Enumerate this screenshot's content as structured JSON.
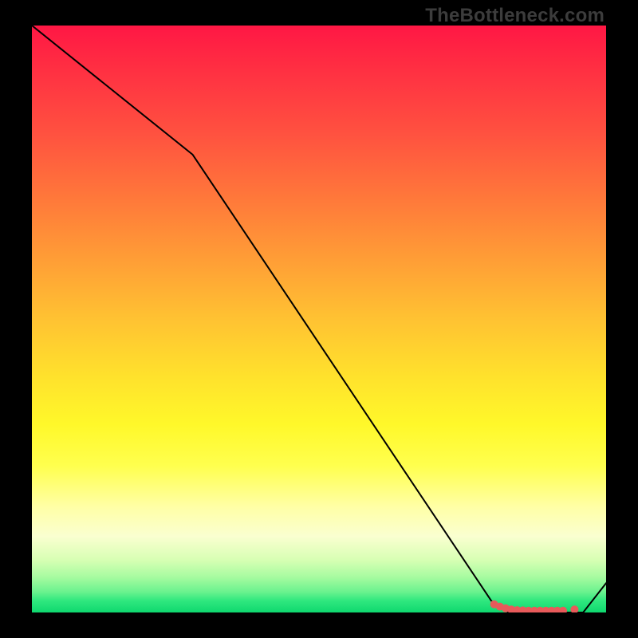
{
  "watermark": "TheBottleneck.com",
  "chart_data": {
    "type": "line",
    "title": "",
    "xlabel": "",
    "ylabel": "",
    "xlim": [
      0,
      100
    ],
    "ylim": [
      0,
      100
    ],
    "series": [
      {
        "name": "curve",
        "x": [
          0,
          28,
          80,
          83,
          96,
          100
        ],
        "y": [
          100,
          78,
          2,
          0,
          0,
          5
        ],
        "stroke": "#000000",
        "stroke_width": 2
      }
    ],
    "markers": {
      "name": "highlight-dots",
      "x": [
        80.5,
        81.5,
        82.5,
        83.5,
        84.5,
        85.5,
        86.5,
        87.5,
        88.5,
        89.5,
        90.5,
        91.5,
        92.5,
        94.5
      ],
      "y": [
        1.4,
        1.0,
        0.7,
        0.5,
        0.4,
        0.35,
        0.3,
        0.3,
        0.3,
        0.3,
        0.3,
        0.3,
        0.3,
        0.5
      ],
      "color": "#e85a5a",
      "radius": 5
    },
    "background": "red-to-green vertical gradient"
  }
}
